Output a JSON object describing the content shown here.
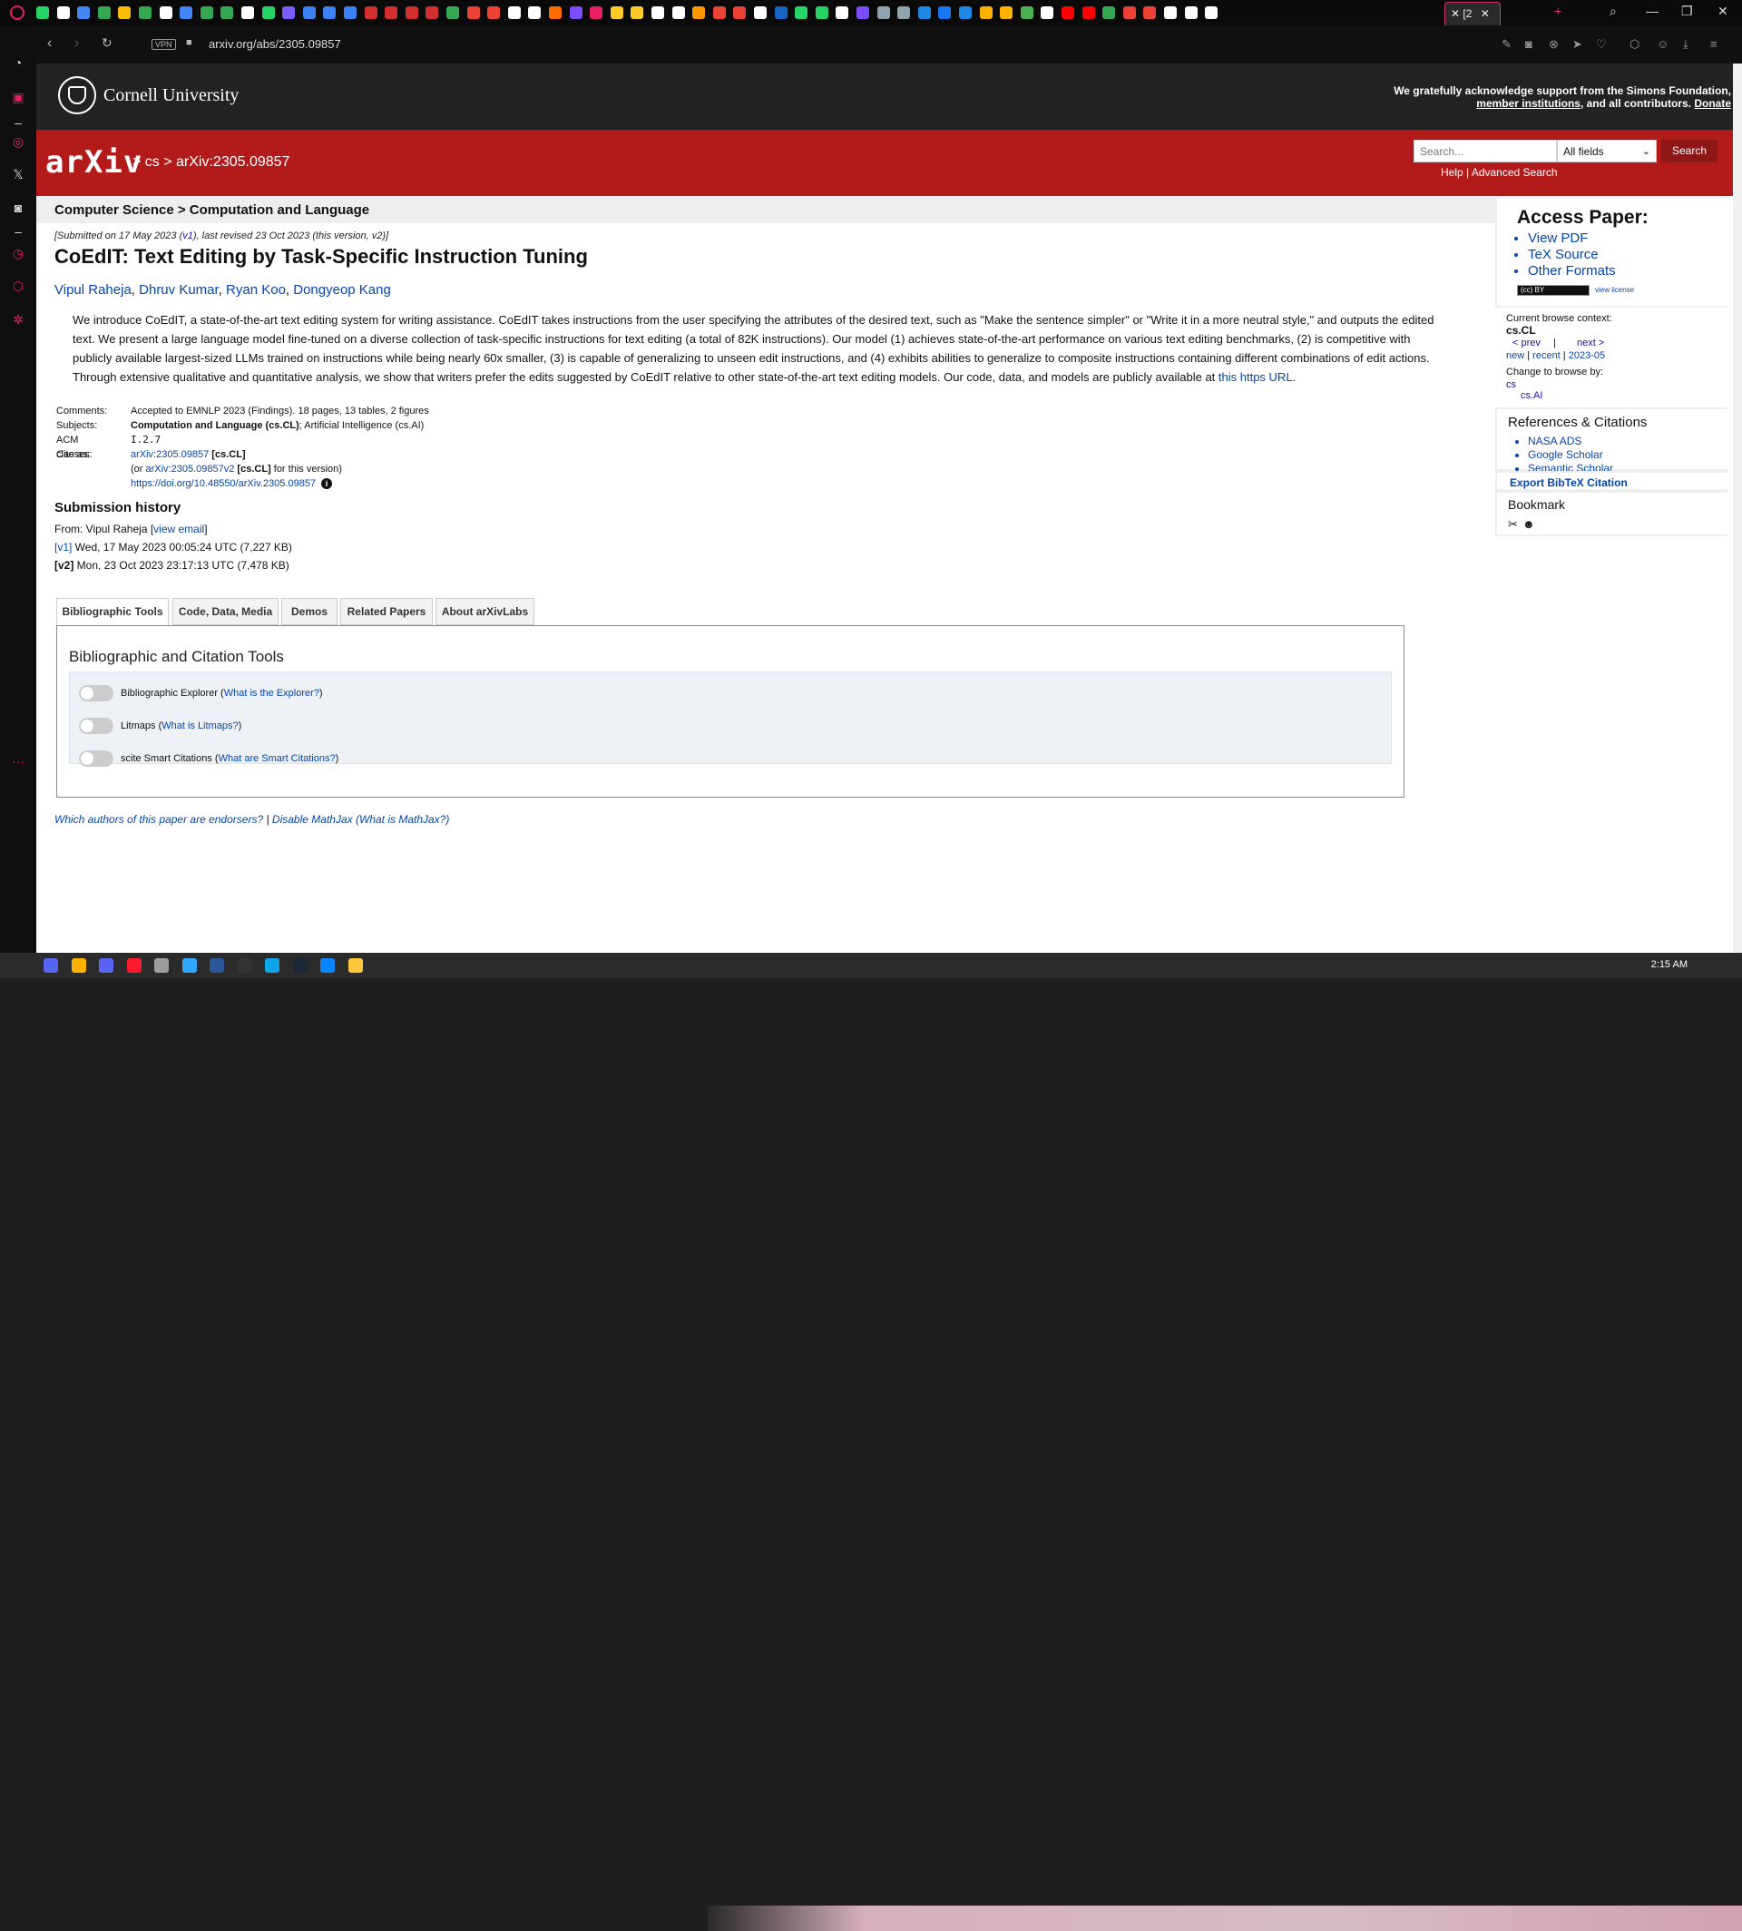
{
  "browser": {
    "tab_title": "[2",
    "url": "arxiv.org/abs/2305.09857",
    "vpn_label": "VPN",
    "tab_icon_colors": [
      "#25d366",
      "#ffffff",
      "#4285f4",
      "#34a853",
      "#fbbc05",
      "#34a853",
      "#ffffff",
      "#4285f4",
      "#34a853",
      "#34a853",
      "#ffffff",
      "#25d366",
      "#7a5cff",
      "#3b82f6",
      "#3b82f6",
      "#3b82f6",
      "#d32f2f",
      "#d32f2f",
      "#d32f2f",
      "#d32f2f",
      "#34a853",
      "#ea4335",
      "#ea4335",
      "#ffffff",
      "#ffffff",
      "#ff6d00",
      "#7c4dff",
      "#e91e63",
      "#ffca28",
      "#ffca28",
      "#ffffff",
      "#ffffff",
      "#ff9800",
      "#ea4335",
      "#ea4335",
      "#ffffff",
      "#1565c0",
      "#25d366",
      "#25d366",
      "#ffffff",
      "#7c4dff",
      "#90a4ae",
      "#90a4ae",
      "#1e88e5",
      "#1877f2",
      "#1e88e5",
      "#ffb300",
      "#ffb300",
      "#4caf50",
      "#ffffff",
      "#ff0000",
      "#ff0000",
      "#34a853",
      "#ea4335",
      "#ea4335",
      "#ffffff",
      "#ffffff",
      "#ffffff"
    ]
  },
  "sidebar_icons": [
    "opera-icon",
    "speed-dial-icon",
    "aria-icon",
    "instagram-icon",
    "x-twitter-icon",
    "discord-icon",
    "history-icon",
    "extensions-icon",
    "settings-icon",
    "more-icon"
  ],
  "cornell": {
    "name": "Cornell University",
    "support_text": "We gratefully acknowledge support from the Simons Foundation,",
    "support_link1": "member institutions",
    "support_mid": ", and all contributors.",
    "support_link2": "Donate"
  },
  "arxiv_header": {
    "logo": "arXiv",
    "breadcrumb": "> cs > arXiv:2305.09857",
    "search_placeholder": "Search...",
    "search_field": "All fields",
    "search_button": "Search",
    "help": "Help",
    "advanced": "Advanced Search"
  },
  "subject_heading": "Computer Science > Computation and Language",
  "paper": {
    "dateline_pre": "[Submitted on 17 May 2023 (",
    "dateline_v1": "v1",
    "dateline_post": "), last revised 23 Oct 2023 (this version, v2)]",
    "title": "CoEdIT: Text Editing by Task-Specific Instruction Tuning",
    "authors": [
      "Vipul Raheja",
      "Dhruv Kumar",
      "Ryan Koo",
      "Dongyeop Kang"
    ],
    "abstract": "We introduce CoEdIT, a state-of-the-art text editing system for writing assistance. CoEdIT takes instructions from the user specifying the attributes of the desired text, such as \"Make the sentence simpler\" or \"Write it in a more neutral style,\" and outputs the edited text. We present a large language model fine-tuned on a diverse collection of task-specific instructions for text editing (a total of 82K instructions). Our model (1) achieves state-of-the-art performance on various text editing benchmarks, (2) is competitive with publicly available largest-sized LLMs trained on instructions while being nearly 60x smaller, (3) is capable of generalizing to unseen edit instructions, and (4) exhibits abilities to generalize to composite instructions containing different combinations of edit actions. Through extensive qualitative and quantitative analysis, we show that writers prefer the edits suggested by CoEdIT relative to other state-of-the-art text editing models. Our code, data, and models are publicly available at",
    "abstract_link": "this https URL",
    "comments_label": "Comments:",
    "comments": "Accepted to EMNLP 2023 (Findings). 18 pages, 13 tables, 2 figures",
    "subjects_label": "Subjects:",
    "subjects_primary": "Computation and Language (cs.CL)",
    "subjects_rest": "; Artificial Intelligence (cs.AI)",
    "acm_label": "ACM classes:",
    "acm": "I.2.7",
    "cite_label": "Cite as:",
    "cite_id": "arXiv:2305.09857",
    "cite_cat": "[cs.CL]",
    "cite_or_pre": "(or ",
    "cite_v2": "arXiv:2305.09857v2",
    "cite_or_post": " for this version)",
    "doi": "https://doi.org/10.48550/arXiv.2305.09857"
  },
  "history": {
    "heading": "Submission history",
    "from": "From: Vipul Raheja [",
    "view_email": "view email",
    "from_end": "]",
    "v1": "[v1]",
    "v1_text": " Wed, 17 May 2023 00:05:24 UTC (7,227 KB)",
    "v2": "[v2]",
    "v2_text": " Mon, 23 Oct 2023 23:17:13 UTC (7,478 KB)"
  },
  "tabs": [
    "Bibliographic Tools",
    "Code, Data, Media",
    "Demos",
    "Related Papers",
    "About arXivLabs"
  ],
  "panel": {
    "title": "Bibliographic and Citation Tools",
    "tools": [
      {
        "name": "Bibliographic Explorer",
        "link": "What is the Explorer?"
      },
      {
        "name": "Litmaps",
        "link": "What is Litmaps?"
      },
      {
        "name": "scite Smart Citations",
        "link": "What are Smart Citations?"
      }
    ]
  },
  "footer": {
    "endorsers": "Which authors of this paper are endorsers?",
    "sep": " | ",
    "mathjax": "Disable MathJax",
    "what_mathjax": "(What is MathJax?)"
  },
  "right": {
    "access_heading": "Access Paper:",
    "access_links": [
      "View PDF",
      "TeX Source",
      "Other Formats"
    ],
    "cc": "(cc) BY",
    "view_license": "view license",
    "context_label": "Current browse context:",
    "context": "cs.CL",
    "prev": "< prev",
    "next": "next >",
    "new": "new",
    "recent": "recent",
    "month": "2023-05",
    "change_label": "Change to browse by:",
    "browse_cs": "cs",
    "browse_ai": "cs.AI",
    "refs_heading": "References & Citations",
    "refs": [
      "NASA ADS",
      "Google Scholar",
      "Semantic Scholar"
    ],
    "bibtex": "Export BibTeX Citation",
    "bookmark": "Bookmark"
  },
  "taskbar": {
    "icon_colors": [
      "#5865f2",
      "#ffb300",
      "#5865f2",
      "#ff1b2d",
      "#9e9e9e",
      "#31a8ff",
      "#2b579a",
      "#333333",
      "#0ea5e9",
      "#1b2838",
      "#0a84ff",
      "#ffc83d"
    ],
    "clock": "2:15 AM"
  }
}
